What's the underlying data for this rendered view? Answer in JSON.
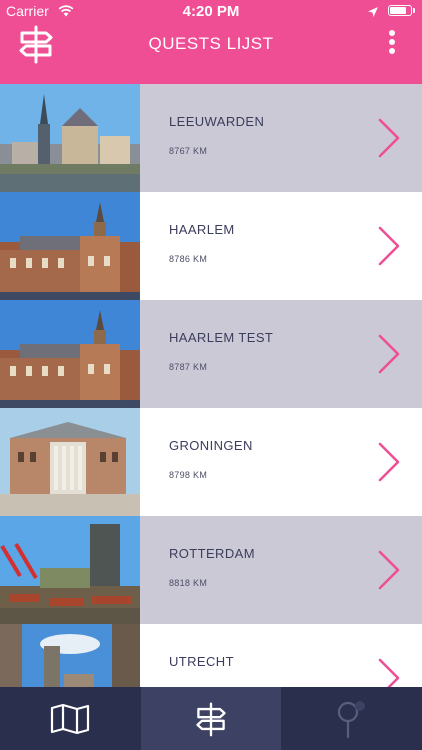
{
  "status_bar": {
    "carrier": "Carrier",
    "time": "4:20 PM",
    "battery_level": 0.85
  },
  "nav_bar": {
    "title": "QUESTS LIJST",
    "logo_icon": "signpost-icon",
    "menu_icon": "more-vertical-icon"
  },
  "quests": [
    {
      "name": "LEEUWARDEN",
      "distance": "8767 KM",
      "image": "leeuwarden-photo",
      "bg": "grey"
    },
    {
      "name": "HAARLEM",
      "distance": "8786 KM",
      "image": "haarlem-photo",
      "bg": "white"
    },
    {
      "name": "HAARLEM TEST",
      "distance": "8787 KM",
      "image": "haarlem-photo",
      "bg": "grey"
    },
    {
      "name": "GRONINGEN",
      "distance": "8798 KM",
      "image": "groningen-photo",
      "bg": "white"
    },
    {
      "name": "ROTTERDAM",
      "distance": "8818 KM",
      "image": "rotterdam-photo",
      "bg": "grey"
    },
    {
      "name": "UTRECHT",
      "distance": "",
      "image": "utrecht-photo",
      "bg": "white"
    }
  ],
  "tab_bar": {
    "tabs": [
      {
        "icon": "map-icon",
        "active": false
      },
      {
        "icon": "signpost-icon",
        "active": true
      },
      {
        "icon": "map-pin-icon",
        "active": false
      }
    ]
  },
  "colors": {
    "accent": "#ef4d94",
    "row_grey": "#ccc9d6",
    "tab_bar": "#2b2f4e",
    "tab_active": "#3d4163",
    "text_dark": "#3a3d5c"
  }
}
